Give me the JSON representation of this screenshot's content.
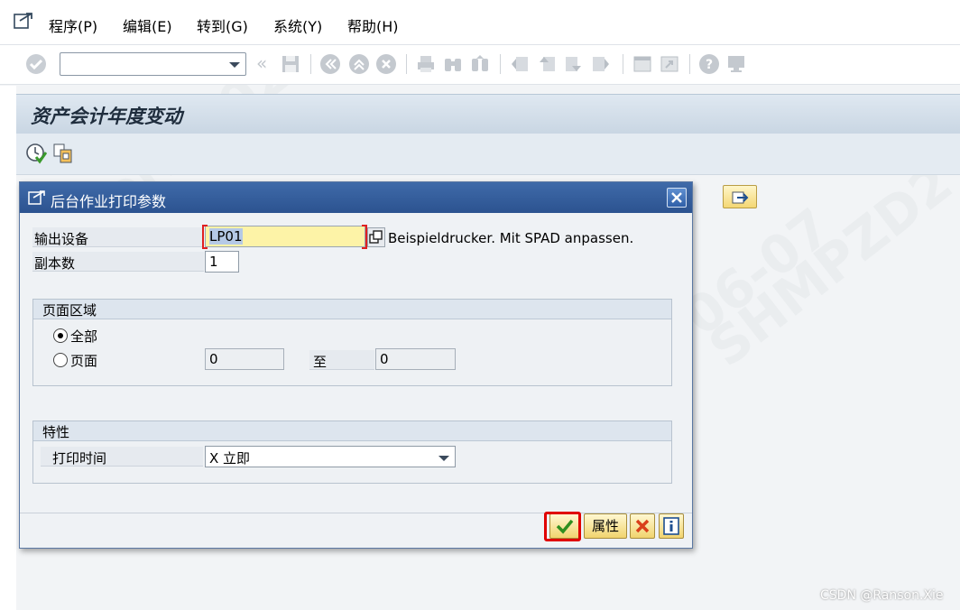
{
  "menu": {
    "items": [
      "程序(P)",
      "编辑(E)",
      "转到(G)",
      "系统(Y)",
      "帮助(H)"
    ]
  },
  "toolbar": {
    "command_field_value": ""
  },
  "page": {
    "title": "资产会计年度变动"
  },
  "dialog": {
    "title": "后台作业打印参数",
    "output_device_label": "输出设备",
    "output_device_value": "LP01",
    "output_device_desc": "Beispieldrucker. Mit SPAD anpassen.",
    "copies_label": "副本数",
    "copies_value": "1",
    "page_area": {
      "header": "页面区域",
      "all_label": "全部",
      "pages_label": "页面",
      "from_value": "0",
      "to_label": "至",
      "to_value": "0",
      "selected": "all"
    },
    "properties": {
      "header": "特性",
      "print_time_label": "打印时间",
      "print_time_value": "X 立即"
    },
    "buttons": {
      "attributes_label": "属性"
    }
  },
  "watermark": {
    "credit": "CSDN @Ranson.Xie"
  },
  "colors": {
    "dialog_title_bg": "#2c5390",
    "required_field_bg": "#fdf3a7",
    "button_bg": "#f1d46e",
    "highlight": "#e00000"
  }
}
